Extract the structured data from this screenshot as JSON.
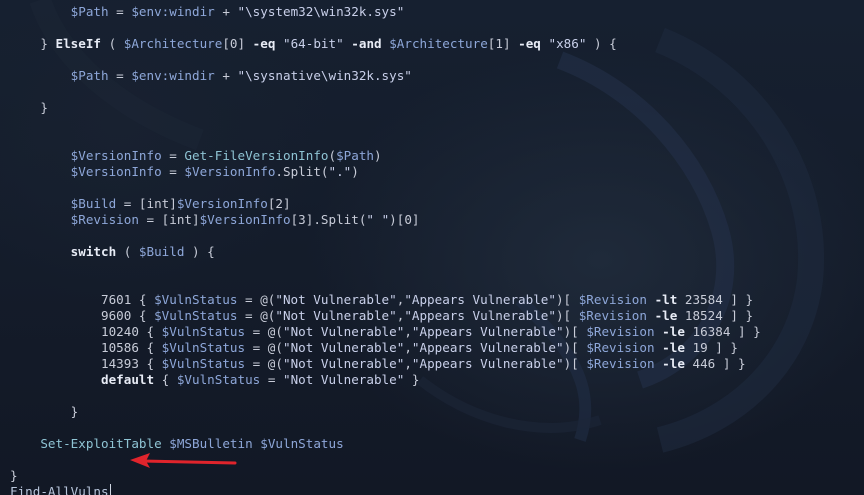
{
  "terminal": {
    "lines": [
      [
        {
          "t": "        "
        },
        {
          "c": "var",
          "t": "$Path"
        },
        {
          "t": " = "
        },
        {
          "c": "var",
          "t": "$env:windir"
        },
        {
          "t": " + "
        },
        {
          "c": "str",
          "t": "\"\\system32\\win32k.sys\""
        }
      ],
      [],
      [
        {
          "t": "    } "
        },
        {
          "c": "kw",
          "t": "ElseIf"
        },
        {
          "t": " ( "
        },
        {
          "c": "var",
          "t": "$Architecture"
        },
        {
          "t": "[0] "
        },
        {
          "c": "kw",
          "t": "-eq"
        },
        {
          "t": " "
        },
        {
          "c": "str",
          "t": "\"64-bit\""
        },
        {
          "t": " "
        },
        {
          "c": "kw",
          "t": "-and"
        },
        {
          "t": " "
        },
        {
          "c": "var",
          "t": "$Architecture"
        },
        {
          "t": "[1] "
        },
        {
          "c": "kw",
          "t": "-eq"
        },
        {
          "t": " "
        },
        {
          "c": "str",
          "t": "\"x86\""
        },
        {
          "t": " ) {"
        }
      ],
      [],
      [
        {
          "t": "        "
        },
        {
          "c": "var",
          "t": "$Path"
        },
        {
          "t": " = "
        },
        {
          "c": "var",
          "t": "$env:windir"
        },
        {
          "t": " + "
        },
        {
          "c": "str",
          "t": "\"\\sysnative\\win32k.sys\""
        }
      ],
      [],
      [
        {
          "t": "    }"
        }
      ],
      [],
      [],
      [
        {
          "t": "        "
        },
        {
          "c": "var",
          "t": "$VersionInfo"
        },
        {
          "t": " = "
        },
        {
          "c": "fn",
          "t": "Get-FileVersionInfo"
        },
        {
          "t": "("
        },
        {
          "c": "var",
          "t": "$Path"
        },
        {
          "t": ")"
        }
      ],
      [
        {
          "t": "        "
        },
        {
          "c": "var",
          "t": "$VersionInfo"
        },
        {
          "t": " = "
        },
        {
          "c": "var",
          "t": "$VersionInfo"
        },
        {
          "t": ".Split("
        },
        {
          "c": "str",
          "t": "\".\""
        },
        {
          "t": ")"
        }
      ],
      [],
      [
        {
          "t": "        "
        },
        {
          "c": "var",
          "t": "$Build"
        },
        {
          "t": " = [int]"
        },
        {
          "c": "var",
          "t": "$VersionInfo"
        },
        {
          "t": "[2]"
        }
      ],
      [
        {
          "t": "        "
        },
        {
          "c": "var",
          "t": "$Revision"
        },
        {
          "t": " = [int]"
        },
        {
          "c": "var",
          "t": "$VersionInfo"
        },
        {
          "t": "[3].Split("
        },
        {
          "c": "str",
          "t": "\" \""
        },
        {
          "t": ")[0]"
        }
      ],
      [],
      [
        {
          "t": "        "
        },
        {
          "c": "kw",
          "t": "switch"
        },
        {
          "t": " ( "
        },
        {
          "c": "var",
          "t": "$Build"
        },
        {
          "t": " ) {"
        }
      ],
      [],
      [],
      [
        {
          "t": "            7601 { "
        },
        {
          "c": "var",
          "t": "$VulnStatus"
        },
        {
          "t": " = @("
        },
        {
          "c": "str",
          "t": "\"Not Vulnerable\""
        },
        {
          "t": ","
        },
        {
          "c": "str",
          "t": "\"Appears Vulnerable\""
        },
        {
          "t": ")[ "
        },
        {
          "c": "var",
          "t": "$Revision"
        },
        {
          "t": " "
        },
        {
          "c": "kw",
          "t": "-lt"
        },
        {
          "t": " 23584 ] }"
        }
      ],
      [
        {
          "t": "            9600 { "
        },
        {
          "c": "var",
          "t": "$VulnStatus"
        },
        {
          "t": " = @("
        },
        {
          "c": "str",
          "t": "\"Not Vulnerable\""
        },
        {
          "t": ","
        },
        {
          "c": "str",
          "t": "\"Appears Vulnerable\""
        },
        {
          "t": ")[ "
        },
        {
          "c": "var",
          "t": "$Revision"
        },
        {
          "t": " "
        },
        {
          "c": "kw",
          "t": "-le"
        },
        {
          "t": " 18524 ] }"
        }
      ],
      [
        {
          "t": "            10240 { "
        },
        {
          "c": "var",
          "t": "$VulnStatus"
        },
        {
          "t": " = @("
        },
        {
          "c": "str",
          "t": "\"Not Vulnerable\""
        },
        {
          "t": ","
        },
        {
          "c": "str",
          "t": "\"Appears Vulnerable\""
        },
        {
          "t": ")[ "
        },
        {
          "c": "var",
          "t": "$Revision"
        },
        {
          "t": " "
        },
        {
          "c": "kw",
          "t": "-le"
        },
        {
          "t": " 16384 ] }"
        }
      ],
      [
        {
          "t": "            10586 { "
        },
        {
          "c": "var",
          "t": "$VulnStatus"
        },
        {
          "t": " = @("
        },
        {
          "c": "str",
          "t": "\"Not Vulnerable\""
        },
        {
          "t": ","
        },
        {
          "c": "str",
          "t": "\"Appears Vulnerable\""
        },
        {
          "t": ")[ "
        },
        {
          "c": "var",
          "t": "$Revision"
        },
        {
          "t": " "
        },
        {
          "c": "kw",
          "t": "-le"
        },
        {
          "t": " 19 ] }"
        }
      ],
      [
        {
          "t": "            14393 { "
        },
        {
          "c": "var",
          "t": "$VulnStatus"
        },
        {
          "t": " = @("
        },
        {
          "c": "str",
          "t": "\"Not Vulnerable\""
        },
        {
          "t": ","
        },
        {
          "c": "str",
          "t": "\"Appears Vulnerable\""
        },
        {
          "t": ")[ "
        },
        {
          "c": "var",
          "t": "$Revision"
        },
        {
          "t": " "
        },
        {
          "c": "kw",
          "t": "-le"
        },
        {
          "t": " 446 ] }"
        }
      ],
      [
        {
          "t": "            "
        },
        {
          "c": "kw",
          "t": "default"
        },
        {
          "t": " { "
        },
        {
          "c": "var",
          "t": "$VulnStatus"
        },
        {
          "t": " = "
        },
        {
          "c": "str",
          "t": "\"Not Vulnerable\""
        },
        {
          "t": " }"
        }
      ],
      [],
      [
        {
          "t": "        }"
        }
      ],
      [],
      [
        {
          "t": "    "
        },
        {
          "c": "fn",
          "t": "Set-ExploitTable"
        },
        {
          "t": " "
        },
        {
          "c": "var",
          "t": "$MSBulletin"
        },
        {
          "t": " "
        },
        {
          "c": "var",
          "t": "$VulnStatus"
        }
      ],
      [],
      [
        {
          "t": "}"
        }
      ]
    ],
    "prompt_command": "Find-AllVulns",
    "empty_line_marker": "~"
  },
  "annotation": {
    "arrow_color": "#e0242c"
  },
  "colors": {
    "background": "#141a26",
    "variable": "#8ea7d9",
    "string": "#c9d0ea",
    "keyword": "#e8ecf6",
    "function": "#8fc4d4",
    "text": "#c8ccd8"
  }
}
